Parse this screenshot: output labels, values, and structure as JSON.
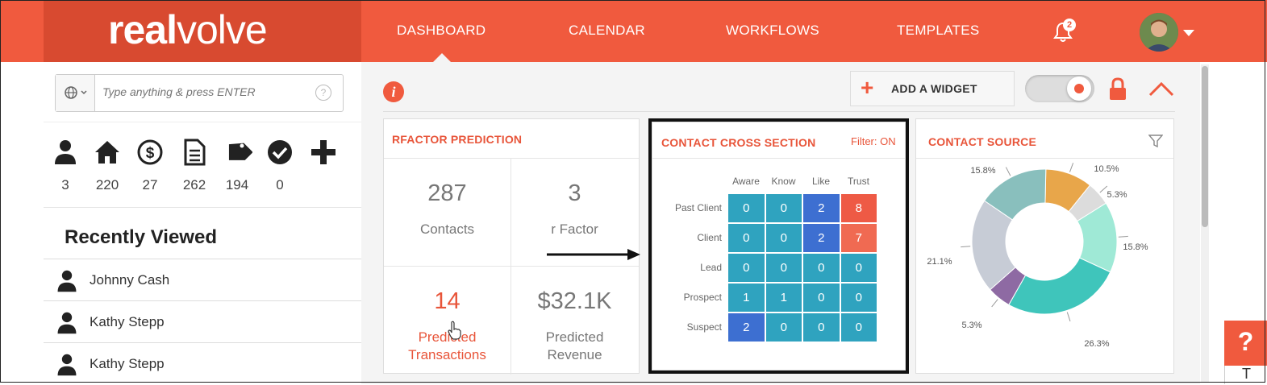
{
  "brand": {
    "bold": "real",
    "light": "volve"
  },
  "nav": {
    "items": [
      "DASHBOARD",
      "CALENDAR",
      "WORKFLOWS",
      "TEMPLATES"
    ],
    "notification_count": "2"
  },
  "search": {
    "placeholder": "Type anything & press ENTER",
    "help": "?"
  },
  "stats": [
    {
      "icon": "person-icon",
      "value": "3"
    },
    {
      "icon": "home-icon",
      "value": "220"
    },
    {
      "icon": "dollar-icon",
      "value": "27"
    },
    {
      "icon": "document-icon",
      "value": "262"
    },
    {
      "icon": "tags-icon",
      "value": "194"
    },
    {
      "icon": "check-circle-icon",
      "value": "0"
    },
    {
      "icon": "plus-icon",
      "value": ""
    }
  ],
  "recently_viewed": {
    "title": "Recently Viewed",
    "items": [
      "Johnny Cash",
      "Kathy Stepp",
      "Kathy Stepp"
    ]
  },
  "toolbar": {
    "add_widget": "ADD A WIDGET",
    "toggle_on": true
  },
  "rfactor": {
    "title": "RFACTOR PREDICTION",
    "cells": [
      {
        "value": "287",
        "label": "Contacts"
      },
      {
        "value": "3",
        "label": "r Factor"
      },
      {
        "value": "14",
        "label": "Predicted Transactions"
      },
      {
        "value": "$32.1K",
        "label": "Predicted Revenue"
      }
    ]
  },
  "cross_section": {
    "title": "CONTACT CROSS SECTION",
    "filter": "Filter: ON",
    "columns": [
      "Aware",
      "Know",
      "Like",
      "Trust"
    ],
    "rows": [
      {
        "label": "Past Client",
        "values": [
          "0",
          "0",
          "2",
          "8"
        ]
      },
      {
        "label": "Client",
        "values": [
          "0",
          "0",
          "2",
          "7"
        ]
      },
      {
        "label": "Lead",
        "values": [
          "0",
          "0",
          "0",
          "0"
        ]
      },
      {
        "label": "Prospect",
        "values": [
          "1",
          "1",
          "0",
          "0"
        ]
      },
      {
        "label": "Suspect",
        "values": [
          "2",
          "0",
          "0",
          "0"
        ]
      }
    ]
  },
  "contact_source": {
    "title": "CONTACT SOURCE",
    "slices": [
      {
        "pct": 10.5,
        "label": "10.5%",
        "color": "#e8a64a"
      },
      {
        "pct": 5.3,
        "label": "5.3%",
        "color": "#dcdcdc"
      },
      {
        "pct": 15.8,
        "label": "15.8%",
        "color": "#9fe9d6"
      },
      {
        "pct": 26.3,
        "label": "26.3%",
        "color": "#3fc5bb"
      },
      {
        "pct": 5.3,
        "label": "5.3%",
        "color": "#8e6aa3"
      },
      {
        "pct": 21.1,
        "label": "21.1%",
        "color": "#c7ccd6"
      },
      {
        "pct": 15.8,
        "label": "15.8%",
        "color": "#89bfbd"
      }
    ]
  },
  "help": {
    "icon": "?"
  }
}
